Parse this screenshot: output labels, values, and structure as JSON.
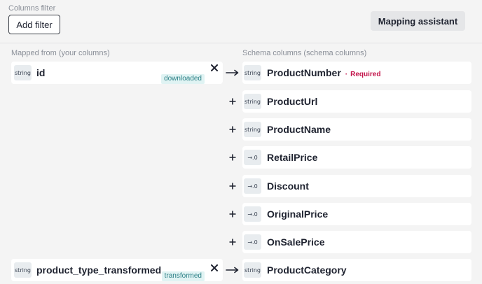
{
  "header": {
    "columns_filter_label": "Columns filter",
    "add_filter_label": "Add filter",
    "mapping_assistant_label": "Mapping assistant"
  },
  "columns": {
    "left_header": "Mapped from (your columns)",
    "right_header": "Schema columns (schema columns)"
  },
  "colors": {
    "required": "#c3154b",
    "status_badge_bg": "#e0f3f3",
    "status_badge_text": "#2b7f85",
    "type_badge_bg": "#e8ecef"
  },
  "rows": [
    {
      "source": {
        "type": "string",
        "name": "id",
        "status": "downloaded"
      },
      "connector": "arrow-right-icon",
      "target": {
        "type": "string",
        "name": "ProductNumber",
        "required": "Required"
      }
    },
    {
      "connector": "plus-icon",
      "target": {
        "type": "string",
        "name": "ProductUrl"
      }
    },
    {
      "connector": "plus-icon",
      "target": {
        "type": "string",
        "name": "ProductName"
      }
    },
    {
      "connector": "plus-icon",
      "target": {
        "type": "→.0",
        "name": "RetailPrice"
      }
    },
    {
      "connector": "plus-icon",
      "target": {
        "type": "→.0",
        "name": "Discount"
      }
    },
    {
      "connector": "plus-icon",
      "target": {
        "type": "→.0",
        "name": "OriginalPrice"
      }
    },
    {
      "connector": "plus-icon",
      "target": {
        "type": "→.0",
        "name": "OnSalePrice"
      }
    },
    {
      "source": {
        "type": "string",
        "name": "product_type_transformed",
        "status": "transformed"
      },
      "connector": "arrow-right-icon",
      "target": {
        "type": "string",
        "name": "ProductCategory"
      }
    }
  ]
}
